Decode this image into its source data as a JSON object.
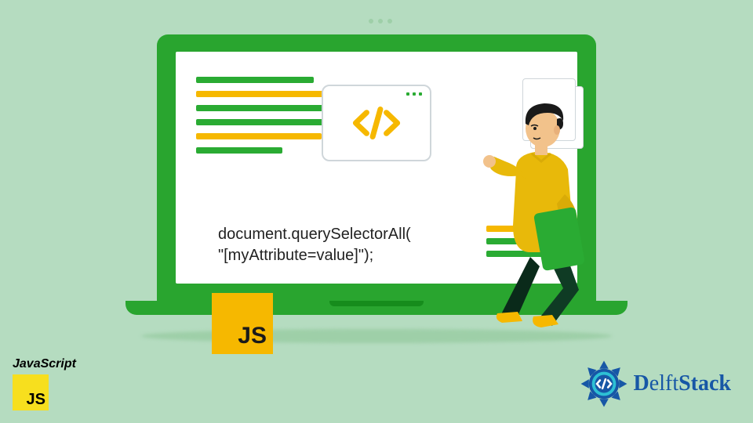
{
  "code": {
    "line1": "document.querySelectorAll(",
    "line2": "\"[myAttribute=value]\");"
  },
  "badge": {
    "js_large": "JS",
    "js_small": "JS",
    "js_label": "JavaScript"
  },
  "brand": {
    "name_bold": "D",
    "name_rest": "elft",
    "name_suffix": "Stack"
  },
  "colors": {
    "bg": "#b5dcc0",
    "green": "#29a52f",
    "yellow": "#f6b800",
    "blue": "#1757a6"
  }
}
